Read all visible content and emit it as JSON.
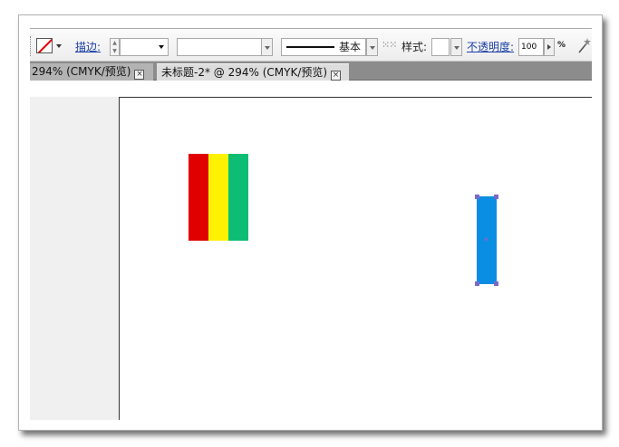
{
  "control_bar": {
    "stroke_label": "描边:",
    "profile_label": "基本",
    "style_label": "样式:",
    "opacity_label": "不透明度:",
    "opacity_value": "100",
    "opacity_unit": "%"
  },
  "tabs": [
    {
      "label": "294% (CMYK/预览)",
      "close": "×",
      "active": false
    },
    {
      "label": "未标题-2* @ 294% (CMYK/预览)",
      "close": "×",
      "active": true
    }
  ],
  "colors": {
    "flag_red": "#e10000",
    "flag_yellow": "#fff200",
    "flag_green": "#0dbd74",
    "selected_rect": "#0a8ee3",
    "selection_handles": "#7b68c8",
    "no_fill_slash": "#e00000"
  },
  "icons": {
    "fill_swatch": "no-fill-swatch-icon",
    "options": "transform-options-icon",
    "tool": "wand-icon"
  }
}
